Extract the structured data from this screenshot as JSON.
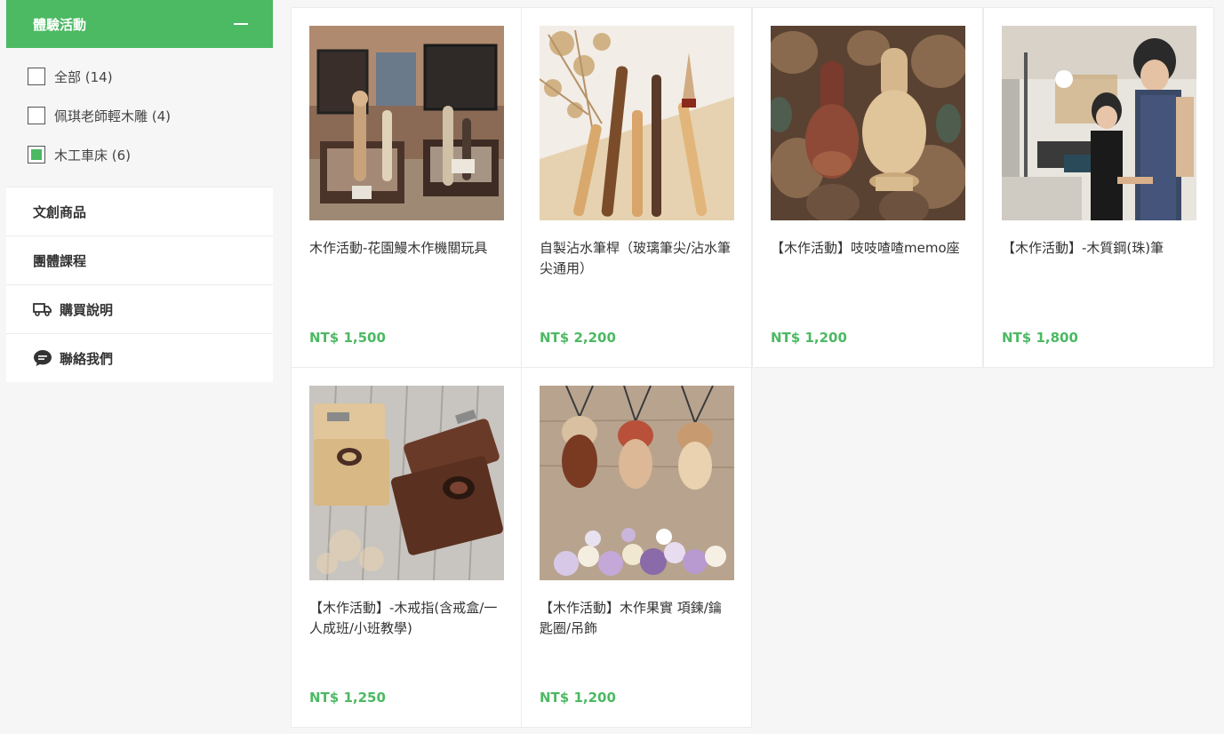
{
  "sidebar": {
    "category": "體驗活動",
    "sub_items": [
      {
        "label": "全部 (14)",
        "checked": false
      },
      {
        "label": "佩琪老師輕木雕 (4)",
        "checked": false
      },
      {
        "label": "木工車床 (6)",
        "checked": true
      }
    ],
    "links": [
      {
        "label": "文創商品",
        "icon": ""
      },
      {
        "label": "團體課程",
        "icon": ""
      },
      {
        "label": "購買說明",
        "icon": "truck-icon"
      },
      {
        "label": "聯絡我們",
        "icon": "chat-bubble-icon"
      }
    ]
  },
  "products": [
    {
      "title": "木作活動-花園鰻木作機關玩具",
      "price": "NT$ 1,500",
      "image": "garden-eel-toys"
    },
    {
      "title": "自製沾水筆桿（玻璃筆尖/沾水筆尖通用）",
      "price": "NT$ 2,200",
      "image": "dip-pen-holders"
    },
    {
      "title": "【木作活動】吱吱喳喳memo座",
      "price": "NT$ 1,200",
      "image": "bird-memo-holders"
    },
    {
      "title": "【木作活動】-木質鋼(珠)筆",
      "price": "NT$ 1,800",
      "image": "lathe-workshop"
    },
    {
      "title": "【木作活動】-木戒指(含戒盒/一人成班/小班教學)",
      "price": "NT$ 1,250",
      "image": "wood-ring-boxes"
    },
    {
      "title": "【木作活動】木作果實 項鍊/鑰匙圈/吊飾",
      "price": "NT$ 1,200",
      "image": "acorn-pendants"
    }
  ],
  "colors": {
    "accent": "#4cb963"
  }
}
